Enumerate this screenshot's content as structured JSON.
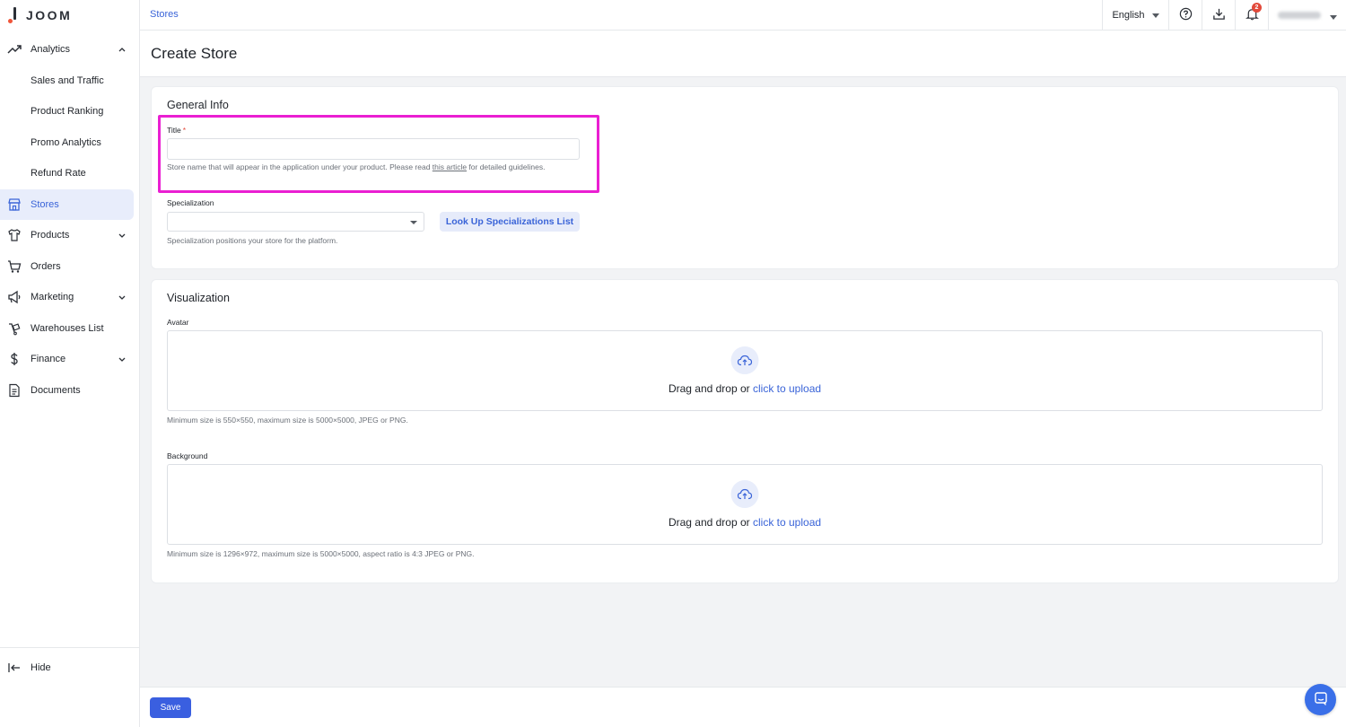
{
  "brand": {
    "name": "JOOM"
  },
  "topbar": {
    "breadcrumb": "Stores",
    "language": "English",
    "notifications_count": "2"
  },
  "sidebar": {
    "analytics": {
      "label": "Analytics",
      "icon": "trend-up-icon"
    },
    "analytics_sub": [
      "Sales and Traffic",
      "Product Ranking",
      "Promo Analytics",
      "Refund Rate"
    ],
    "stores": {
      "label": "Stores",
      "icon": "store-icon"
    },
    "products": {
      "label": "Products",
      "icon": "shirt-icon"
    },
    "orders": {
      "label": "Orders",
      "icon": "cart-icon"
    },
    "marketing": {
      "label": "Marketing",
      "icon": "megaphone-icon"
    },
    "warehouses": {
      "label": "Warehouses List",
      "icon": "warehouse-icon"
    },
    "finance": {
      "label": "Finance",
      "icon": "dollar-icon"
    },
    "documents": {
      "label": "Documents",
      "icon": "document-icon"
    },
    "hide": "Hide"
  },
  "page": {
    "title": "Create Store"
  },
  "general_info": {
    "heading": "General Info",
    "title_label": "Title",
    "title_required": "*",
    "title_value": "",
    "title_hint_before": "Store name that will appear in the application under your product. Please read ",
    "title_hint_link": "this article",
    "title_hint_after": " for detailed guidelines.",
    "specialization_label": "Specialization",
    "specialization_value": "",
    "lookup_button": "Look Up Specializations List",
    "specialization_hint": "Specialization positions your store for the platform."
  },
  "visualization": {
    "heading": "Visualization",
    "avatar_label": "Avatar",
    "avatar_drop_text": "Drag and drop or ",
    "avatar_drop_link": "click to upload",
    "avatar_hint": "Minimum size is 550×550, maximum size is 5000×5000, JPEG or PNG.",
    "background_label": "Background",
    "background_drop_text": "Drag and drop or ",
    "background_drop_link": "click to upload",
    "background_hint": "Minimum size is 1296×972, maximum size is 5000×5000, aspect ratio is 4:3 JPEG or PNG."
  },
  "footer": {
    "save_label": "Save"
  },
  "colors": {
    "accent": "#3a64d8",
    "highlight": "#ea1fd2",
    "badge": "#e24a3b"
  }
}
